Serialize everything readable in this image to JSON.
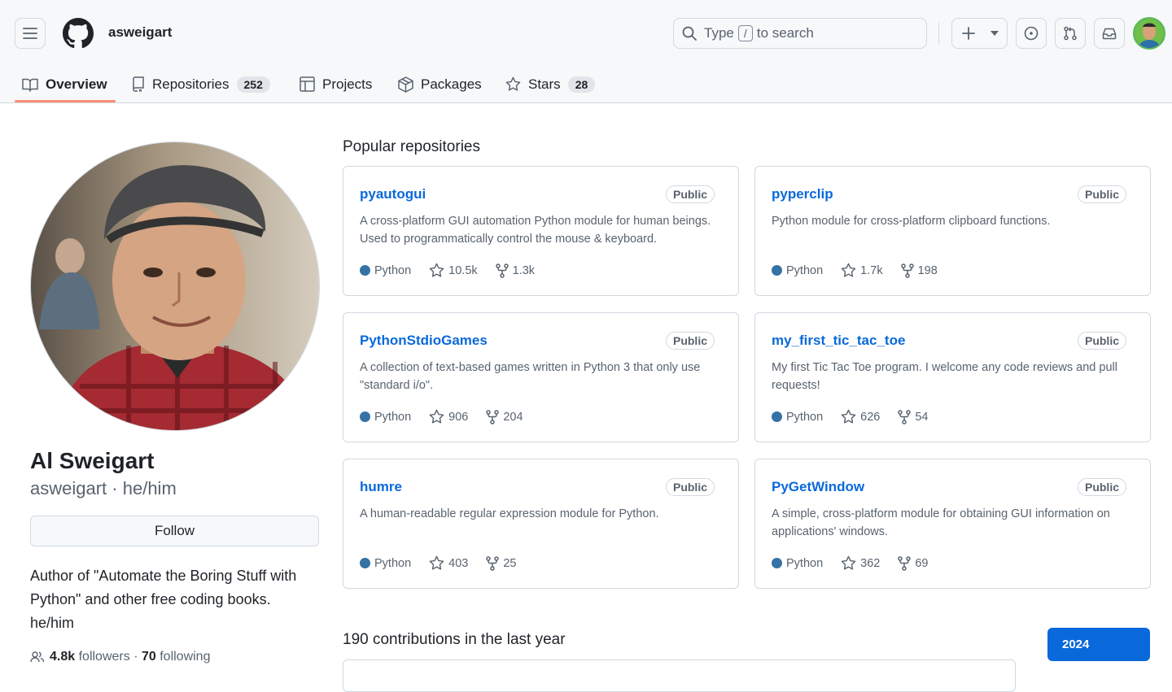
{
  "header": {
    "username": "asweigart",
    "search": {
      "prefix": "Type",
      "key": "/",
      "suffix": "to search"
    },
    "icons": [
      "hamburger-icon",
      "github-logo-icon",
      "search-icon",
      "plus-icon",
      "caret-down-icon",
      "issues-icon",
      "pull-request-icon",
      "inbox-icon"
    ]
  },
  "tabs": [
    {
      "label": "Overview",
      "count": "",
      "icon": "book-icon",
      "active": true
    },
    {
      "label": "Repositories",
      "count": "252",
      "icon": "repo-icon"
    },
    {
      "label": "Projects",
      "count": "",
      "icon": "table-icon"
    },
    {
      "label": "Packages",
      "count": "",
      "icon": "package-icon"
    },
    {
      "label": "Stars",
      "count": "28",
      "icon": "star-icon"
    }
  ],
  "profile": {
    "full_name": "Al Sweigart",
    "login": "asweigart",
    "pronouns": "he/him",
    "separator": "·",
    "follow_label": "Follow",
    "bio": "Author of \"Automate the Boring Stuff with Python\" and other free coding books. he/him",
    "followers": "4.8k",
    "followers_label": "followers",
    "following": "70",
    "following_label": "following"
  },
  "popular": {
    "title": "Popular repositories",
    "repos": [
      {
        "name": "pyautogui",
        "visibility": "Public",
        "description": "A cross-platform GUI automation Python module for human beings. Used to programmatically control the mouse & keyboard.",
        "language": "Python",
        "stars": "10.5k",
        "forks": "1.3k"
      },
      {
        "name": "pyperclip",
        "visibility": "Public",
        "description": "Python module for cross-platform clipboard functions.",
        "language": "Python",
        "stars": "1.7k",
        "forks": "198"
      },
      {
        "name": "PythonStdioGames",
        "visibility": "Public",
        "description": "A collection of text-based games written in Python 3 that only use \"standard i/o\".",
        "language": "Python",
        "stars": "906",
        "forks": "204"
      },
      {
        "name": "my_first_tic_tac_toe",
        "visibility": "Public",
        "description": "My first Tic Tac Toe program. I welcome any code reviews and pull requests!",
        "language": "Python",
        "stars": "626",
        "forks": "54"
      },
      {
        "name": "humre",
        "visibility": "Public",
        "description": "A human-readable regular expression module for Python.",
        "language": "Python",
        "stars": "403",
        "forks": "25"
      },
      {
        "name": "PyGetWindow",
        "visibility": "Public",
        "description": "A simple, cross-platform module for obtaining GUI information on applications' windows.",
        "language": "Python",
        "stars": "362",
        "forks": "69"
      }
    ]
  },
  "contributions": {
    "title": "190 contributions in the last year",
    "year": "2024"
  },
  "colors": {
    "link": "#0969da",
    "python": "#3572a5",
    "tab_underline": "#fd8c73",
    "header_bg": "#f6f8fa",
    "border": "#d1d9e0"
  }
}
